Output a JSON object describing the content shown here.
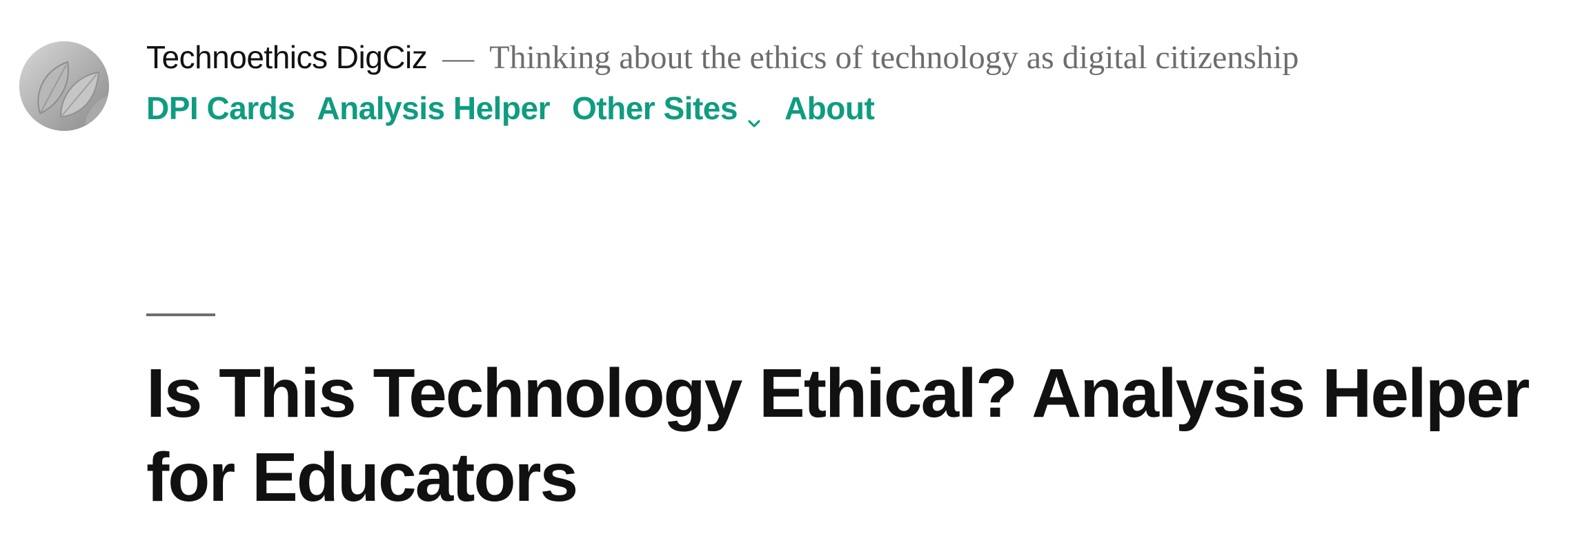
{
  "header": {
    "site_title": "Technoethics DigCiz",
    "separator": "—",
    "tagline": "Thinking about the ethics of technology as digital citizenship"
  },
  "nav": {
    "items": [
      {
        "label": "DPI Cards"
      },
      {
        "label": "Analysis Helper"
      },
      {
        "label": "Other Sites",
        "has_submenu": true,
        "icon": "chevron-down-icon"
      },
      {
        "label": "About"
      }
    ]
  },
  "post": {
    "title": "Is This Technology Ethical? Analysis Helper for Educators"
  },
  "colors": {
    "accent": "#0f9c80",
    "text": "#111111",
    "muted": "#6d6d6d",
    "background": "#ffffff"
  }
}
